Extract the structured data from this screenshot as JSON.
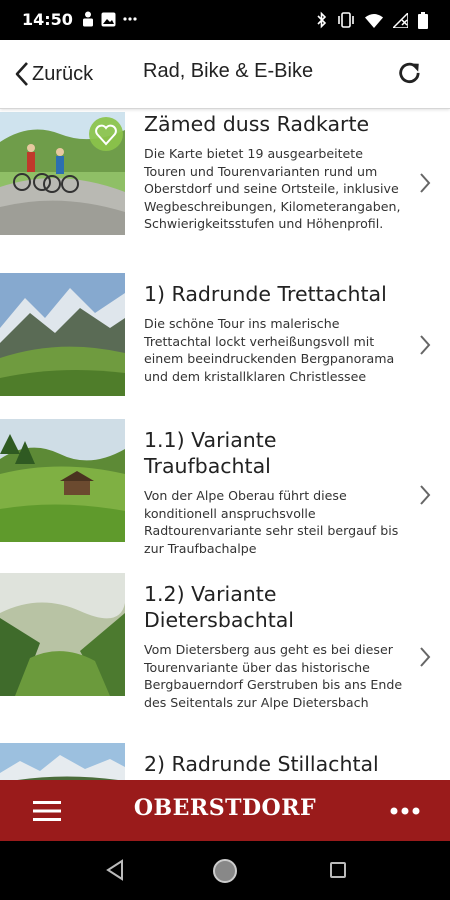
{
  "status_bar": {
    "time": "14:50"
  },
  "header": {
    "back_label": "Zurück",
    "title": "Rad, Bike & E-Bike"
  },
  "items": [
    {
      "title": "Zämed duss Radkarte",
      "description": "Die Karte bietet 19 ausgearbeitete Touren und Tourenvarianten rund um Oberstdorf und seine Ortsteile, inklusive Wegbeschreibungen, Kilometerangaben, Schwierigkeitsstufen und Höhenprofil."
    },
    {
      "title": "1) Radrunde Trettachtal",
      "description": "Die schöne Tour ins malerische Trettachtal lockt verheißungsvoll mit einem beeindruckenden Bergpanorama und dem kristallklaren Christlessee"
    },
    {
      "title": "1.1) Variante Traufbachtal",
      "description": "Von der Alpe Oberau führt diese konditionell anspruchsvolle Radtourenvariante sehr steil bergauf bis zur Traufbachalpe"
    },
    {
      "title": "1.2) Variante Dietersbachtal",
      "description": "Vom Dietersberg aus geht es bei dieser Tourenvariante über das historische Bergbauerndorf Gerstruben bis ans Ende des Seitentals zur Alpe Dietersbach"
    },
    {
      "title": "2) Radrunde Stillachtal",
      "description": ""
    }
  ],
  "bottom_bar": {
    "brand": "OBERSTDORF",
    "color": "#9a1b1b"
  }
}
